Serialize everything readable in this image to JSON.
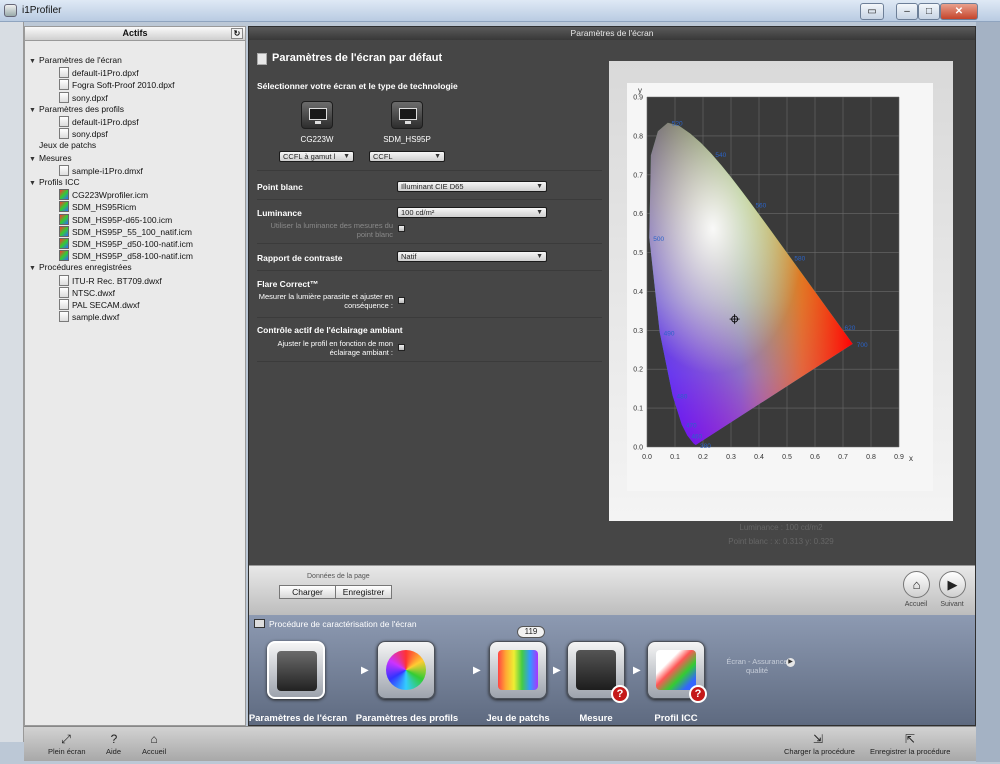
{
  "window": {
    "title": "i1Profiler",
    "controls": [
      "▭",
      "–",
      "□",
      "✕"
    ]
  },
  "sidebar": {
    "header": "Actifs",
    "refresh_icon": "↻",
    "tree": [
      {
        "label": "Paramètres de l'écran",
        "type": "folder",
        "level": 0
      },
      {
        "label": "default-i1Pro.dpxf",
        "type": "file",
        "level": 1
      },
      {
        "label": "Fogra Soft-Proof 2010.dpxf",
        "type": "file",
        "level": 1
      },
      {
        "label": "sony.dpxf",
        "type": "file",
        "level": 1
      },
      {
        "label": "Paramètres des profils",
        "type": "folder",
        "level": 0
      },
      {
        "label": "default-i1Pro.dpsf",
        "type": "file",
        "level": 1
      },
      {
        "label": "sony.dpsf",
        "type": "file",
        "level": 1
      },
      {
        "label": "Jeux de patchs",
        "type": "folder-plain",
        "level": 0
      },
      {
        "label": "Mesures",
        "type": "folder",
        "level": 0
      },
      {
        "label": "sample-i1Pro.dmxf",
        "type": "file",
        "level": 1
      },
      {
        "label": "Profils ICC",
        "type": "folder",
        "level": 0
      },
      {
        "label": "CG223Wprofiler.icm",
        "type": "icc",
        "level": 1
      },
      {
        "label": "SDM_HS95Ricm",
        "type": "icc",
        "level": 1
      },
      {
        "label": "SDM_HS95P-d65-100.icm",
        "type": "icc",
        "level": 1
      },
      {
        "label": "SDM_HS95P_55_100_natif.icm",
        "type": "icc",
        "level": 1
      },
      {
        "label": "SDM_HS95P_d50-100-natif.icm",
        "type": "icc",
        "level": 1
      },
      {
        "label": "SDM_HS95P_d58-100-natif.icm",
        "type": "icc",
        "level": 1
      },
      {
        "label": "Procédures enregistrées",
        "type": "folder",
        "level": 0
      },
      {
        "label": "ITU-R Rec. BT709.dwxf",
        "type": "file",
        "level": 1
      },
      {
        "label": "NTSC.dwxf",
        "type": "file",
        "level": 1
      },
      {
        "label": "PAL SECAM.dwxf",
        "type": "file",
        "level": 1
      },
      {
        "label": "sample.dwxf",
        "type": "file",
        "level": 1
      }
    ]
  },
  "main": {
    "header": "Paramètres de l'écran",
    "title": "Paramètres de l'écran par défaut",
    "select_section": "Sélectionner votre écran et le type de technologie",
    "monitors": [
      {
        "name": "CG223W",
        "tech": "CCFL à gamut l"
      },
      {
        "name": "SDM_HS95P",
        "tech": "CCFL"
      }
    ],
    "white_point": {
      "label": "Point blanc",
      "value": "Illuminant CIE D65"
    },
    "luminance": {
      "label": "Luminance",
      "value": "100 cd/m²",
      "option_label": "Utiliser la luminance des mesures du point blanc"
    },
    "contrast": {
      "label": "Rapport de contraste",
      "value": "Natif"
    },
    "flare": {
      "title": "Flare Correct™",
      "option_label": "Mesurer la lumière parasite et ajuster en conséquence :"
    },
    "ambient": {
      "title": "Contrôle actif de l'éclairage ambiant",
      "option_label": "Ajuster le profil en fonction de mon éclairage ambiant :"
    },
    "chart_info": {
      "luminance_text": "Luminance :  100 cd/m2",
      "white_point_text": "Point blanc : x: 0.313  y: 0.329"
    }
  },
  "chart_data": {
    "type": "scatter",
    "title": "",
    "xlabel": "x",
    "ylabel": "y",
    "xlim": [
      0,
      0.9
    ],
    "ylim": [
      0,
      0.9
    ],
    "grid": true,
    "x_ticks": [
      "0.0",
      "0.1",
      "0.2",
      "0.3",
      "0.4",
      "0.5",
      "0.6",
      "0.7",
      "0.8",
      "0.9"
    ],
    "y_ticks": [
      "0.0",
      "0.1",
      "0.2",
      "0.3",
      "0.4",
      "0.5",
      "0.6",
      "0.7",
      "0.8",
      "0.9"
    ],
    "wavelength_labels": [
      {
        "text": "380",
        "x": 0.175,
        "y": 0.005
      },
      {
        "text": "460",
        "x": 0.144,
        "y": 0.03
      },
      {
        "text": "470",
        "x": 0.124,
        "y": 0.058
      },
      {
        "text": "480",
        "x": 0.091,
        "y": 0.133
      },
      {
        "text": "490",
        "x": 0.045,
        "y": 0.295
      },
      {
        "text": "500",
        "x": 0.008,
        "y": 0.538
      },
      {
        "text": "520",
        "x": 0.074,
        "y": 0.834
      },
      {
        "text": "540",
        "x": 0.23,
        "y": 0.754
      },
      {
        "text": "560",
        "x": 0.373,
        "y": 0.624
      },
      {
        "text": "580",
        "x": 0.512,
        "y": 0.487
      },
      {
        "text": "620",
        "x": 0.691,
        "y": 0.308
      },
      {
        "text": "700",
        "x": 0.735,
        "y": 0.265
      }
    ],
    "white_point": {
      "x": 0.313,
      "y": 0.329
    }
  },
  "bottombar": {
    "page_data_label": "Données de la page",
    "load_label": "Charger",
    "save_label": "Enregistrer",
    "home_label": "Accueil",
    "next_label": "Suivant"
  },
  "workflow": {
    "title": "Procédure de caractérisation de l'écran",
    "patch_count": "119",
    "steps": [
      {
        "label": "Paramètres de l'écran"
      },
      {
        "label": "Paramètres des profils"
      },
      {
        "label": "Jeu de patchs"
      },
      {
        "label": "Mesure"
      },
      {
        "label": "Profil ICC"
      }
    ],
    "next_text": "Écran - Assurance qualité",
    "warning_badge": "?"
  },
  "footer": {
    "fullscreen_label": "Plein écran",
    "help_label": "Aide",
    "home_label": "Accueil",
    "load_procedure_label": "Charger la procédure",
    "save_procedure_label": "Enregistrer la procédure"
  }
}
